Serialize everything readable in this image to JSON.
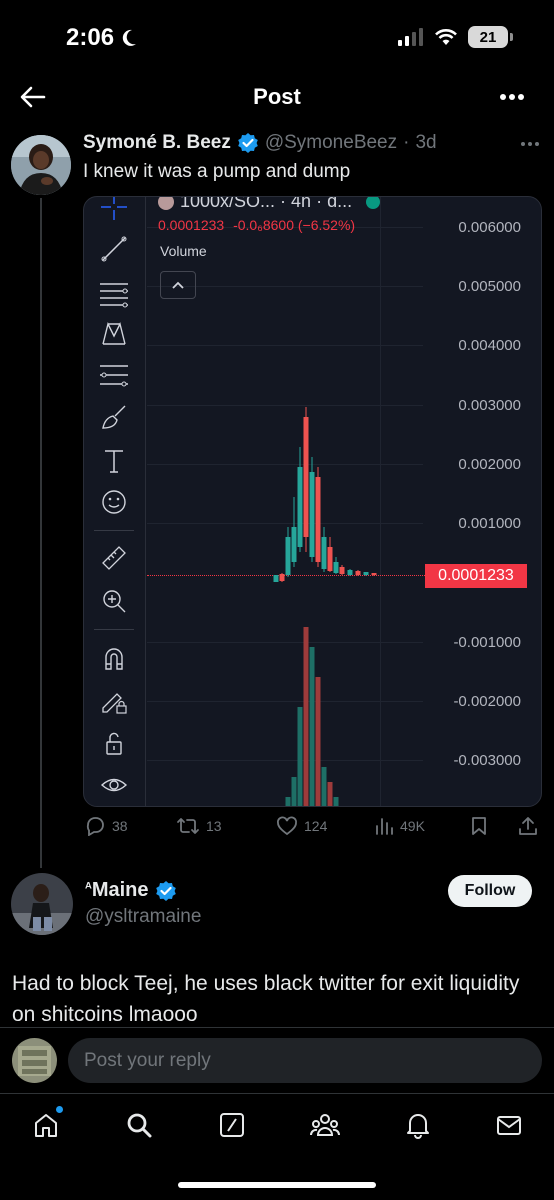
{
  "status_bar": {
    "time": "2:06",
    "battery": "21"
  },
  "header": {
    "title": "Post"
  },
  "tweet": {
    "author_name": "Symoné B. Beez",
    "handle": "@SymoneBeez",
    "separator": "·",
    "age": "3d",
    "text": "I knew it was a pump and dump",
    "chart": {
      "symbol": "1000x/SO... · 4h · d...",
      "price": "0.0001233",
      "change": "-0.0₆8600 (−6.52%)",
      "volume_label": "Volume",
      "price_axis": [
        "0.006000",
        "0.005000",
        "0.004000",
        "0.003000",
        "0.002000",
        "0.001000",
        "-0.001000",
        "-0.002000",
        "-0.003000"
      ],
      "current_price_tag": "0.0001233",
      "colors": {
        "up": "#26a69a",
        "down": "#ef5350",
        "tag": "#f23645"
      }
    },
    "actions": {
      "replies": "38",
      "reposts": "13",
      "likes": "124",
      "views": "49K"
    }
  },
  "reply": {
    "author_name": "Maine",
    "name_prefix": "ᴬ",
    "handle": "@ysltramaine",
    "follow_label": "Follow",
    "text": "Had to block Teej, he uses black twitter for exit liquidity on shitcoins lmaooo"
  },
  "composer": {
    "placeholder": "Post your reply"
  },
  "tabs": [
    "home-icon",
    "search-icon",
    "grok-icon",
    "communities-icon",
    "notifications-icon",
    "messages-icon"
  ],
  "colors": {
    "verified": "#1d9bf0",
    "background": "#000000",
    "notification_dot": "#1d9bf0"
  }
}
